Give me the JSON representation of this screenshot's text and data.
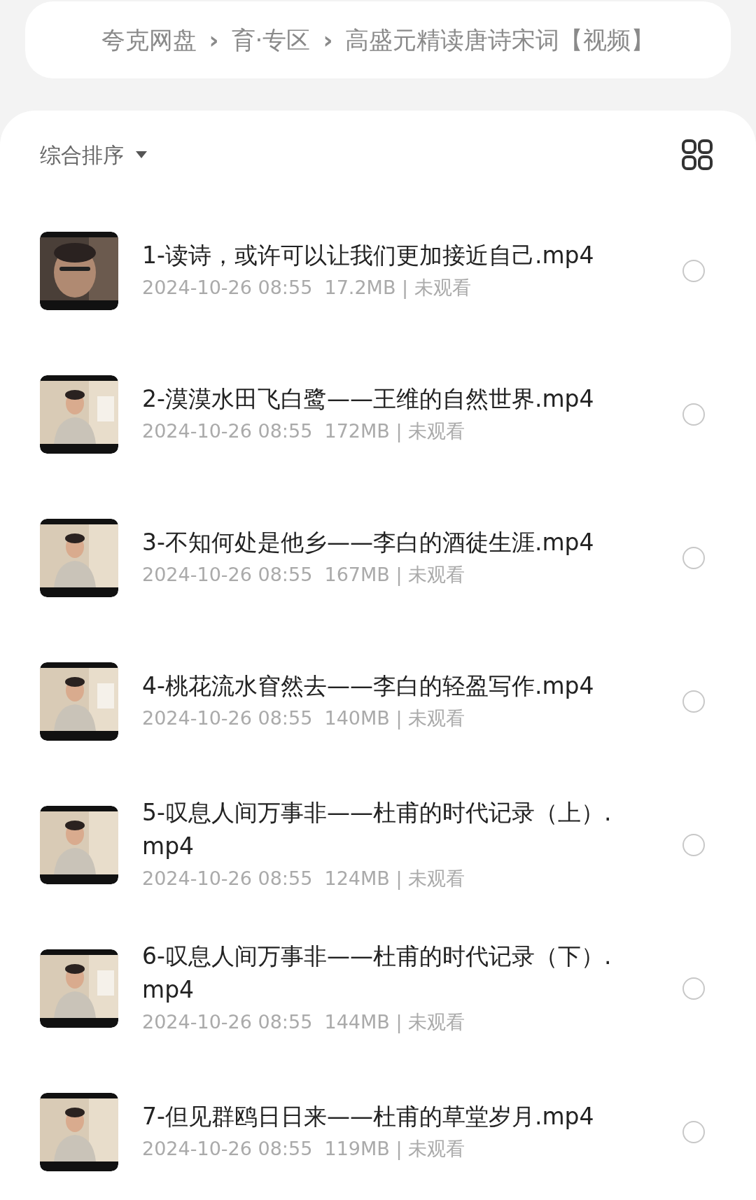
{
  "breadcrumb": [
    "夸克网盘",
    "育·专区",
    "高盛元精读唐诗宋词【视频】"
  ],
  "breadcrumb_separator": "›",
  "sort": {
    "label": "综合排序"
  },
  "files": [
    {
      "kind": "picture",
      "title": "1-读诗，或许可以让我们更加接近自己.mp4",
      "meta": "2024-10-26 08:55  17.2MB | 未观看",
      "selected": false
    },
    {
      "kind": "picture",
      "title": "2-漠漠水田飞白鹭——王维的自然世界.mp4",
      "meta": "2024-10-26 08:55  172MB | 未观看",
      "selected": false
    },
    {
      "kind": "picture",
      "title": "3-不知何处是他乡——李白的酒徒生涯.mp4",
      "meta": "2024-10-26 08:55  167MB | 未观看",
      "selected": false
    },
    {
      "kind": "picture",
      "title": "4-桃花流水窅然去——李白的轻盈写作.mp4",
      "meta": "2024-10-26 08:55  140MB | 未观看",
      "selected": false
    },
    {
      "kind": "picture",
      "title": "5-叹息人间万事非——杜甫的时代记录（上）.mp4",
      "meta": "2024-10-26 08:55  124MB | 未观看",
      "selected": false
    },
    {
      "kind": "picture",
      "title": "6-叹息人间万事非——杜甫的时代记录（下）.mp4",
      "meta": "2024-10-26 08:55  144MB | 未观看",
      "selected": false
    },
    {
      "kind": "picture",
      "title": "7-但见群鸥日日来——杜甫的草堂岁月.mp4",
      "meta": "2024-10-26 08:55  119MB | 未观看",
      "selected": false
    }
  ]
}
